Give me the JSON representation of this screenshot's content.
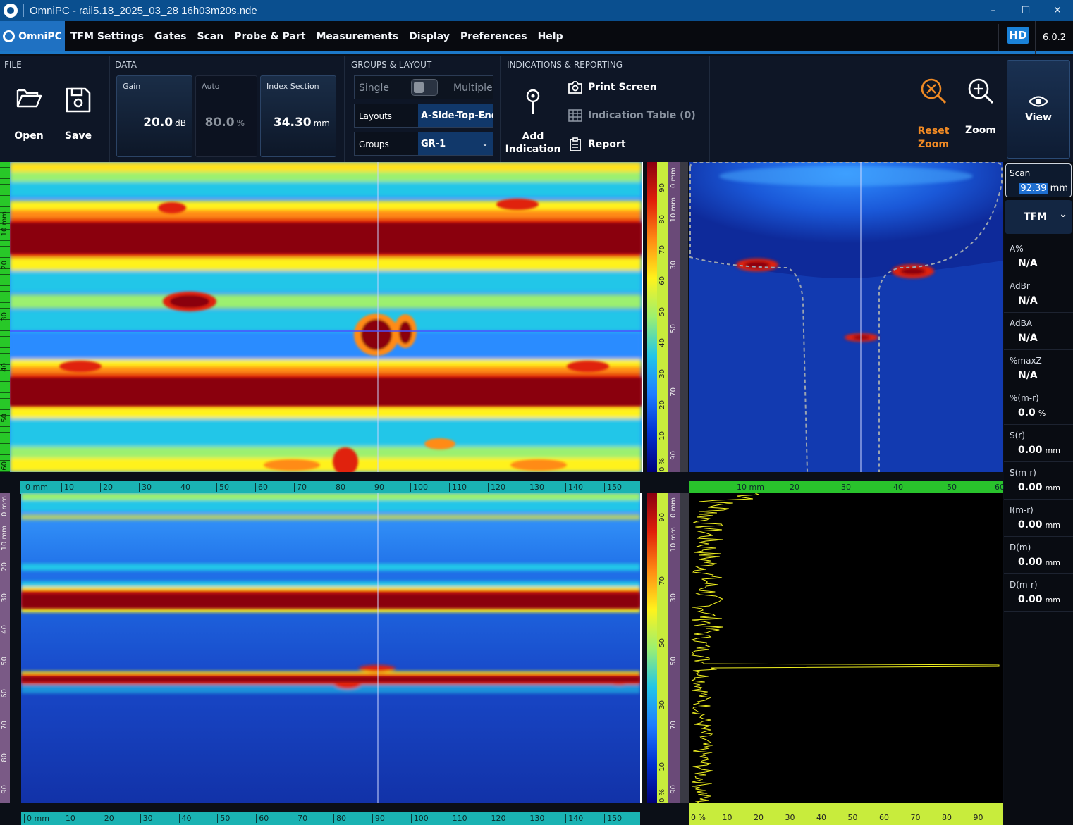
{
  "window": {
    "title": "OmniPC - rail5.18_2025_03_28 16h03m20s.nde",
    "minimize": "–",
    "maximize": "☐",
    "close": "✕"
  },
  "menu": {
    "brand": "OmniPC",
    "items": [
      "TFM Settings",
      "Gates",
      "Scan",
      "Probe & Part",
      "Measurements",
      "Display",
      "Preferences",
      "Help"
    ],
    "hd": "HD",
    "version": "6.0.2"
  },
  "ribbon": {
    "file": {
      "title": "FILE",
      "open": "Open",
      "save": "Save"
    },
    "data": {
      "title": "DATA",
      "gain": {
        "label": "Gain",
        "value": "20.0",
        "unit": "dB"
      },
      "auto": {
        "label": "Auto",
        "value": "80.0",
        "unit": "%"
      },
      "index_section": {
        "label": "Index Section",
        "value": "34.30",
        "unit": "mm"
      }
    },
    "groups_layout": {
      "title": "GROUPS & LAYOUT",
      "single": "Single",
      "multiple": "Multiple",
      "layouts_label": "Layouts",
      "layouts_value": "A-Side-Top-End",
      "groups_label": "Groups",
      "groups_value": "GR-1"
    },
    "indications": {
      "title": "INDICATIONS & REPORTING",
      "add_indication_1": "Add",
      "add_indication_2": "Indication",
      "print_screen": "Print Screen",
      "indication_table": "Indication Table (0)",
      "report": "Report"
    },
    "zoom": {
      "reset_1": "Reset",
      "reset_2": "Zoom",
      "zoom": "Zoom",
      "view": "View"
    }
  },
  "readings": {
    "scan": {
      "label": "Scan",
      "value": "92.39",
      "unit": "mm"
    },
    "mode": "TFM",
    "items": [
      {
        "label": "A%",
        "value": "N/A",
        "unit": ""
      },
      {
        "label": "AdBr",
        "value": "N/A",
        "unit": ""
      },
      {
        "label": "AdBA",
        "value": "N/A",
        "unit": ""
      },
      {
        "label": "%maxZ",
        "value": "N/A",
        "unit": ""
      },
      {
        "label": "%(m-r)",
        "value": "0.0",
        "unit": "%"
      },
      {
        "label": "S(r)",
        "value": "0.00",
        "unit": "mm"
      },
      {
        "label": "S(m-r)",
        "value": "0.00",
        "unit": "mm"
      },
      {
        "label": "I(m-r)",
        "value": "0.00",
        "unit": "mm"
      },
      {
        "label": "D(m)",
        "value": "0.00",
        "unit": "mm"
      },
      {
        "label": "D(m-r)",
        "value": "0.00",
        "unit": "mm"
      }
    ]
  },
  "rulers": {
    "scan_axis": [
      "0 mm",
      "10",
      "20",
      "30",
      "40",
      "50",
      "60",
      "70",
      "80",
      "90",
      "100",
      "110",
      "120",
      "130",
      "140",
      "150"
    ],
    "depth_axis_top": [
      "10 mm",
      "20",
      "30",
      "40",
      "50",
      "60"
    ],
    "depth_axis_bottom": [
      "0 mm",
      "10 mm",
      "20",
      "30",
      "40",
      "50",
      "60",
      "70",
      "80",
      "90"
    ],
    "end_view_axis": [
      "10 mm",
      "20",
      "30",
      "40",
      "50",
      "60"
    ],
    "amplitude_axis": [
      "0 %",
      "10",
      "20",
      "30",
      "40",
      "50",
      "60",
      "70",
      "80",
      "90"
    ],
    "color_palette_top": [
      "90",
      "80",
      "70",
      "60",
      "50",
      "40",
      "30",
      "20",
      "10",
      "0 %"
    ],
    "color_palette_depth": [
      "0 mm",
      "10 mm",
      "20",
      "30",
      "40",
      "50",
      "60",
      "70",
      "80",
      "90"
    ]
  },
  "colors": {
    "accent": "#1c78c8",
    "brand": "#1f71c2",
    "zoom_orange": "#f08a24",
    "palette": [
      "#00007a",
      "#0030d0",
      "#1e7cff",
      "#22c6e8",
      "#9cf070",
      "#fff21c",
      "#ff8b14",
      "#e0200a",
      "#8a0010"
    ]
  }
}
